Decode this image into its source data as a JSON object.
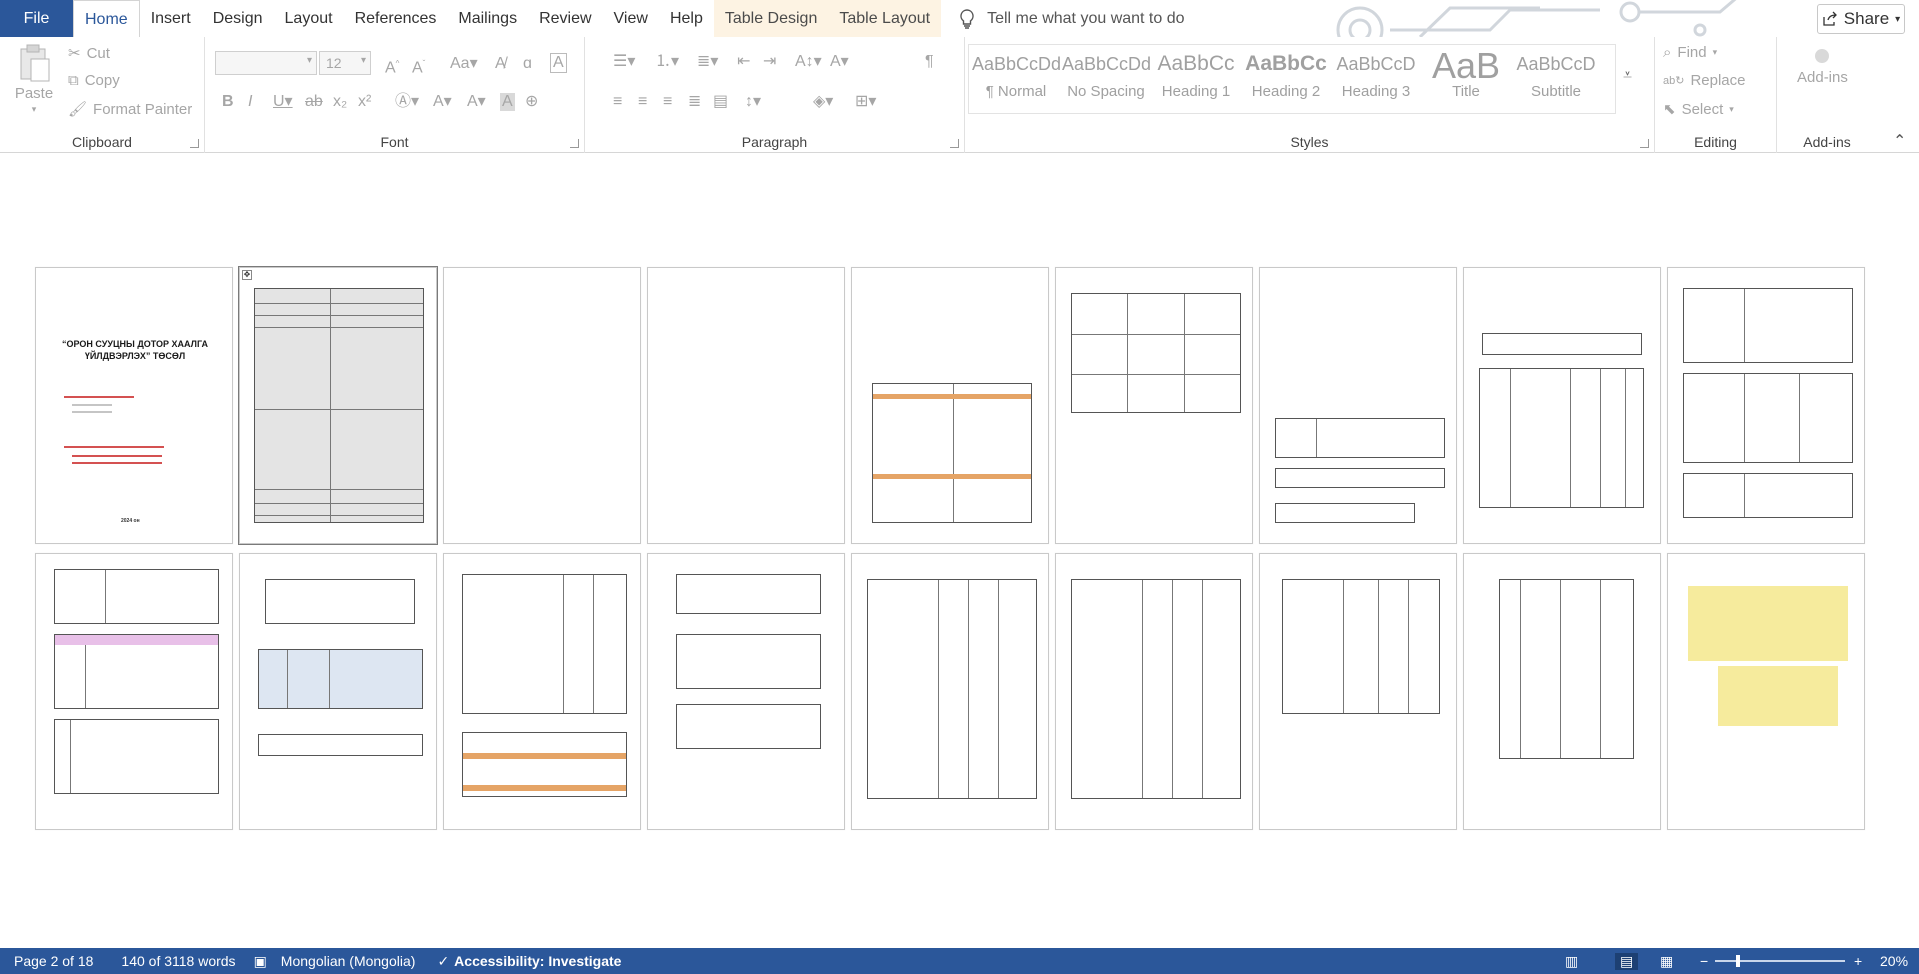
{
  "tabs": {
    "file": "File",
    "items": [
      "Home",
      "Insert",
      "Design",
      "Layout",
      "References",
      "Mailings",
      "Review",
      "View",
      "Help"
    ],
    "active": "Home",
    "context_tabs": [
      "Table Design",
      "Table Layout"
    ],
    "tell_me": "Tell me what you want to do",
    "share": "Share"
  },
  "ribbon": {
    "clipboard": {
      "paste": "Paste",
      "cut": "Cut",
      "copy": "Copy",
      "format_painter": "Format Painter",
      "label": "Clipboard"
    },
    "font": {
      "size": "12",
      "label": "Font"
    },
    "paragraph": {
      "label": "Paragraph"
    },
    "styles": {
      "items": [
        {
          "preview": "AaBbCcDd",
          "name": "¶ Normal"
        },
        {
          "preview": "AaBbCcDd",
          "name": "No Spacing"
        },
        {
          "preview": "AaBbCc",
          "name": "Heading 1"
        },
        {
          "preview": "AaBbCc",
          "name": "Heading 2"
        },
        {
          "preview": "AaBbCcD",
          "name": "Heading 3"
        },
        {
          "preview": "AaB",
          "name": "Title"
        },
        {
          "preview": "AaBbCcD",
          "name": "Subtitle"
        }
      ],
      "label": "Styles"
    },
    "editing": {
      "find": "Find",
      "replace": "Replace",
      "select": "Select",
      "label": "Editing"
    },
    "addins": {
      "button": "Add-ins",
      "label": "Add-ins"
    }
  },
  "pages": {
    "cover_title": "“ОРОН СУУЦНЫ ДОТОР ХААЛГА ҮЙЛДВЭРЛЭХ” ТӨСӨЛ",
    "cover_year": "2024 он"
  },
  "status": {
    "page": "Page 2 of 18",
    "words": "140 of 3118 words",
    "language": "Mongolian (Mongolia)",
    "accessibility": "Accessibility: Investigate",
    "zoom": "20%"
  }
}
